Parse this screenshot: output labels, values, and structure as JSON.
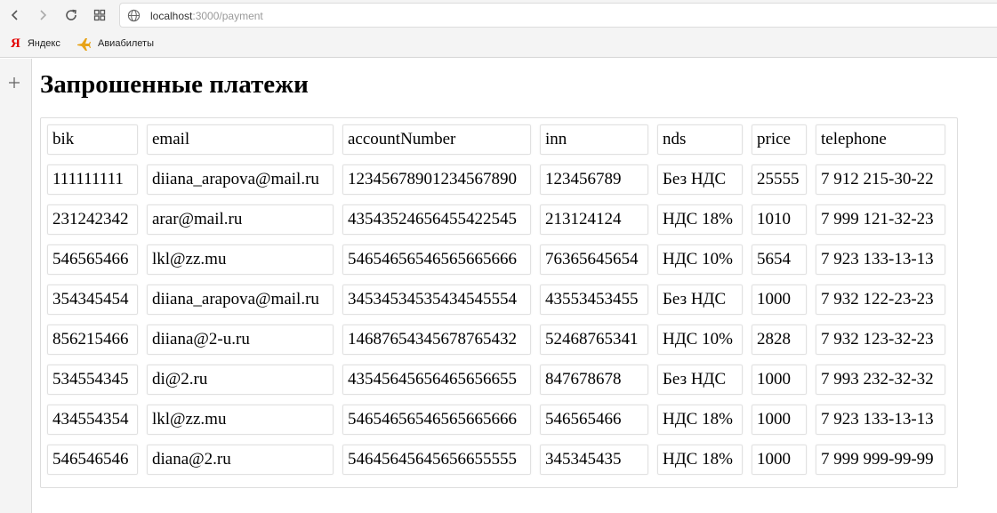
{
  "browser": {
    "url_host": "localhost",
    "url_path": ":3000/payment",
    "bookmarks": [
      {
        "label": "Яндекс",
        "icon": "yandex-icon"
      },
      {
        "label": "Авиабилеты",
        "icon": "plane-icon"
      }
    ],
    "yandex_glyph": "Я"
  },
  "page": {
    "title": "Запрошенные платежи"
  },
  "table": {
    "headers": [
      "bik",
      "email",
      "accountNumber",
      "inn",
      "nds",
      "price",
      "telephone"
    ],
    "rows": [
      [
        "111111111",
        "diiana_arapova@mail.ru",
        "12345678901234567890",
        "123456789",
        "Без НДС",
        "25555",
        "7 912 215-30-22"
      ],
      [
        "231242342",
        "arar@mail.ru",
        "43543524656455422545",
        "213124124",
        "НДС 18%",
        "1010",
        "7 999 121-32-23"
      ],
      [
        "546565466",
        "lkl@zz.mu",
        "54654656546565665666",
        "76365645654",
        "НДС 10%",
        "5654",
        "7 923 133-13-13"
      ],
      [
        "354345454",
        "diiana_arapova@mail.ru",
        "34534534535434545554",
        "43553453455",
        "Без НДС",
        "1000",
        "7 932 122-23-23"
      ],
      [
        "856215466",
        "diiana@2-u.ru",
        "14687654345678765432",
        "52468765341",
        "НДС 10%",
        "2828",
        "7 932 123-32-23"
      ],
      [
        "534554345",
        "di@2.ru",
        "43545645656465656655",
        "847678678",
        "Без НДС",
        "1000",
        "7 993 232-32-32"
      ],
      [
        "434554354",
        "lkl@zz.mu",
        "54654656546565665666",
        "546565466",
        "НДС 18%",
        "1000",
        "7 923 133-13-13"
      ],
      [
        "546546546",
        "diana@2.ru",
        "54645645645656655555",
        "345345435",
        "НДС 18%",
        "1000",
        "7 999 999-99-99"
      ]
    ]
  }
}
